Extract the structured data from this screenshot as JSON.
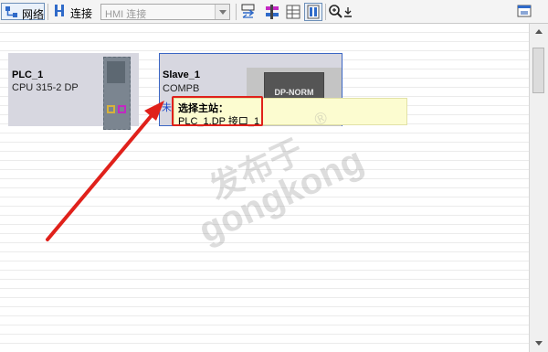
{
  "toolbar": {
    "network_label": "网络",
    "connection_label": "连接",
    "hmi_select_value": "HMI 连接"
  },
  "devices": {
    "plc": {
      "name": "PLC_1",
      "type": "CPU 315-2 DP"
    },
    "slave": {
      "name": "Slave_1",
      "type": "COMPB",
      "module_label": "DP-NORM",
      "status_text": "未"
    }
  },
  "tooltip": {
    "title": "选择主站：",
    "value": "PLC_1.DP 接口_1"
  },
  "watermark": {
    "line1": "发布于",
    "line2": "gongkong",
    "mark": "®"
  },
  "colors": {
    "highlight": "#e0211b",
    "selection_border": "#3b66c4",
    "tooltip_bg": "#fcfcd0",
    "device_bg": "#d7d7e0"
  }
}
